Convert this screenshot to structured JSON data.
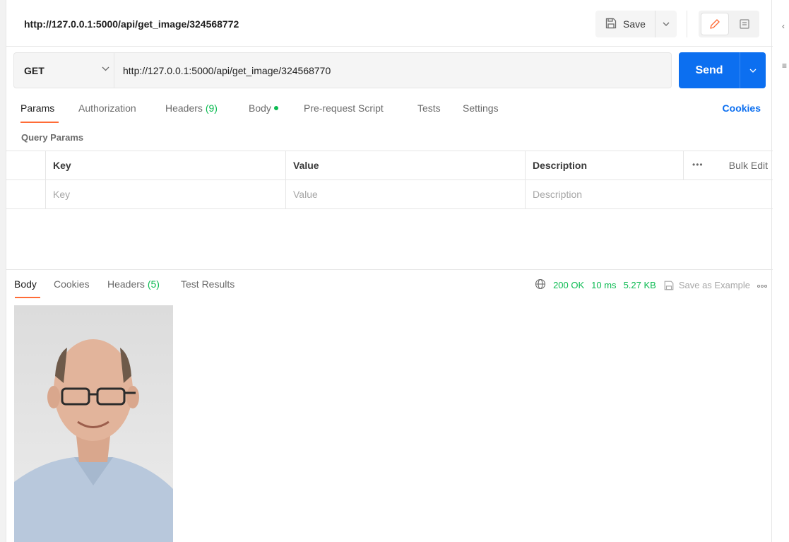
{
  "title_bar": {
    "tab_title": "http://127.0.0.1:5000/api/get_image/324568772",
    "save_label": "Save"
  },
  "request": {
    "method": "GET",
    "url": "http://127.0.0.1:5000/api/get_image/324568770",
    "send_label": "Send"
  },
  "request_tabs": {
    "params": "Params",
    "authorization": "Authorization",
    "headers": "Headers",
    "headers_count": "(9)",
    "body": "Body",
    "pre_request_script": "Pre-request Script",
    "tests": "Tests",
    "settings": "Settings",
    "cookies": "Cookies"
  },
  "query_params": {
    "section_title": "Query Params",
    "columns": [
      "Key",
      "Value",
      "Description"
    ],
    "bulk_edit": "Bulk Edit",
    "placeholders": {
      "key": "Key",
      "value": "Value",
      "description": "Description"
    }
  },
  "response": {
    "tabs": {
      "body": "Body",
      "cookies": "Cookies",
      "headers": "Headers",
      "headers_count": "(5)",
      "test_results": "Test Results"
    },
    "status": "200 OK",
    "time": "10 ms",
    "size": "5.27 KB",
    "save_as_example": "Save as Example"
  },
  "colors": {
    "accent_orange": "#ff6c37",
    "send_blue": "#0c6ff0",
    "success_green": "#0cbb52"
  },
  "icons": [
    "save-icon",
    "chevron-down-icon",
    "pencil-icon",
    "comment-icon",
    "globe-icon",
    "more-icon"
  ]
}
